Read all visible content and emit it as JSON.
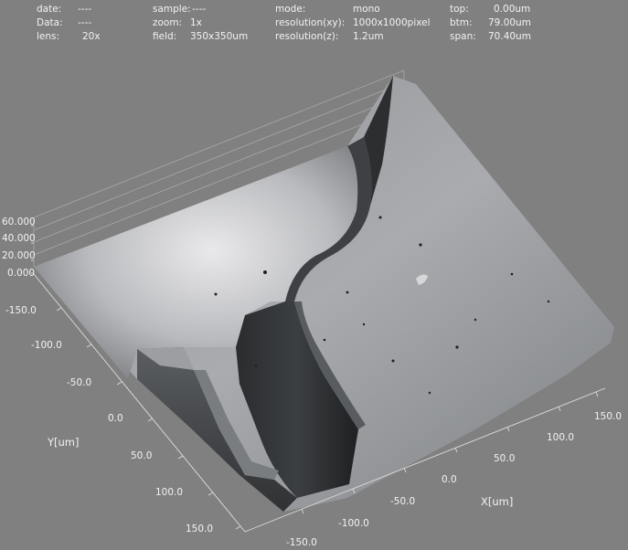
{
  "header": {
    "date": {
      "label": "date:",
      "value": "----"
    },
    "data": {
      "label": "Data:",
      "value": "----"
    },
    "lens": {
      "label": "lens:",
      "value": "20x"
    },
    "sample": {
      "label": "sample:",
      "value": "----"
    },
    "zoom": {
      "label": "zoom:",
      "value": "1x"
    },
    "field": {
      "label": "field:",
      "value": "350x350um"
    },
    "mode": {
      "label": "mode:",
      "value": "mono"
    },
    "res_xy": {
      "label": "resolution(xy):",
      "value": "1000x1000pixel"
    },
    "res_z": {
      "label": "resolution(z):",
      "value": "1.2um"
    },
    "top": {
      "label": "top:",
      "value": "0.00um"
    },
    "btm": {
      "label": "btm:",
      "value": "79.00um"
    },
    "span": {
      "label": "span:",
      "value": "70.40um"
    }
  },
  "view3d": {
    "x_axis_label": "X[um]",
    "y_axis_label": "Y[um]",
    "z_ticks": [
      "60.000",
      "40.000",
      "20.000",
      "0.000"
    ],
    "y_ticks": [
      "-150.0",
      "-100.0",
      "-50.0",
      "0.0",
      "50.0",
      "100.0",
      "150.0"
    ],
    "x_ticks": [
      "-150.0",
      "-100.0",
      "-50.0",
      "0.0",
      "50.0",
      "100.0",
      "150.0"
    ]
  }
}
